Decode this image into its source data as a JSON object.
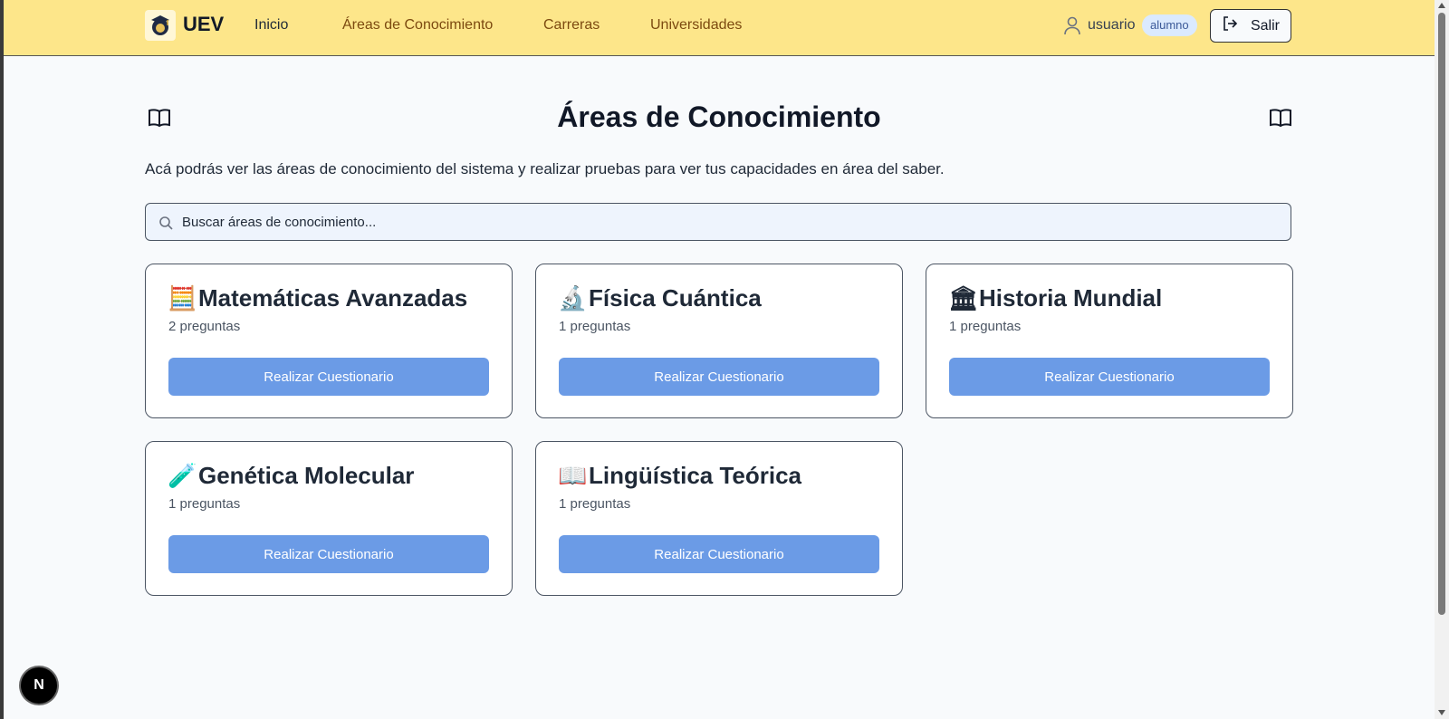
{
  "header": {
    "brand": "UEV",
    "nav": [
      {
        "label": "Inicio",
        "active": true
      },
      {
        "label": "Áreas de Conocimiento",
        "active": false
      },
      {
        "label": "Carreras",
        "active": false
      },
      {
        "label": "Universidades",
        "active": false
      }
    ],
    "username": "usuario",
    "role": "alumno",
    "logout_label": "Salir"
  },
  "main": {
    "title": "Áreas de Conocimiento",
    "description": "Acá podrás ver las áreas de conocimiento del sistema y realizar pruebas para ver tus capacidades en área del saber.",
    "search_placeholder": "Buscar áreas de conocimiento...",
    "cards": [
      {
        "emoji": "🧮",
        "title": "Matemáticas Avanzadas",
        "count": "2 preguntas",
        "button": "Realizar Cuestionario"
      },
      {
        "emoji": "🔬",
        "title": "Física Cuántica",
        "count": "1 preguntas",
        "button": "Realizar Cuestionario"
      },
      {
        "emoji": "🏛",
        "title": "Historia Mundial",
        "count": "1 preguntas",
        "button": "Realizar Cuestionario"
      },
      {
        "emoji": "🧪",
        "title": "Genética Molecular",
        "count": "1 preguntas",
        "button": "Realizar Cuestionario"
      },
      {
        "emoji": "📖",
        "title": "Lingüística Teórica",
        "count": "1 preguntas",
        "button": "Realizar Cuestionario"
      }
    ]
  },
  "badge": "N",
  "colors": {
    "header_bg": "#fde68a",
    "button_bg": "#6b9be6",
    "page_bg": "#f8fafc"
  }
}
